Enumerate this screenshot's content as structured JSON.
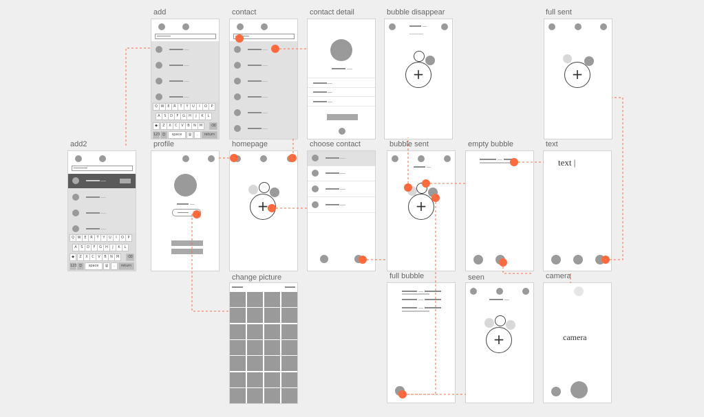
{
  "screens": {
    "add": "add",
    "contact": "contact",
    "contact_detail": "contact detail",
    "bubble_disappear": "bubble disappear",
    "full_sent": "full sent",
    "add2": "add2",
    "profile": "profile",
    "homepage": "homepage",
    "choose_contact": "choose contact",
    "bubble_sent": "bubble sent",
    "empty_bubble": "empty bubble",
    "text": "text",
    "change_picture": "change picture",
    "full_bubble": "full bubble",
    "seen": "seen",
    "camera": "camera"
  },
  "text_screen": {
    "input": "text |"
  },
  "camera_screen": {
    "label": "camera"
  },
  "keyboard": {
    "row1": [
      "Q",
      "W",
      "E",
      "R",
      "T",
      "Y",
      "U",
      "I",
      "O",
      "P"
    ],
    "row2": [
      "A",
      "S",
      "D",
      "F",
      "G",
      "H",
      "J",
      "K",
      "L"
    ],
    "row3": [
      "Z",
      "X",
      "C",
      "V",
      "B",
      "N",
      "M"
    ],
    "space": "space",
    "return": "return",
    "num": "123",
    "at": "@"
  },
  "colors": {
    "accent": "#ff6a3d",
    "background": "#efefef"
  }
}
